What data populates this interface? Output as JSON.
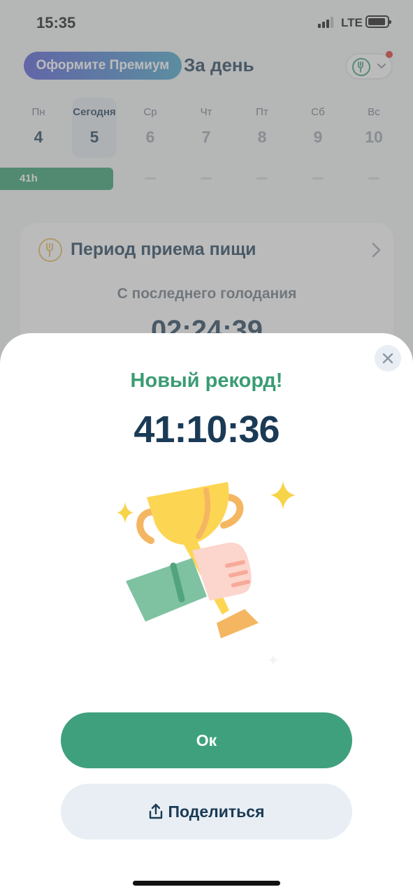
{
  "status_bar": {
    "time": "15:35",
    "network": "LTE"
  },
  "header": {
    "premium_label": "Оформите Премиум",
    "title": "За день",
    "diet_icon": "fork-icon"
  },
  "week": {
    "days": [
      {
        "name": "Пн",
        "num": "4",
        "state": "past"
      },
      {
        "name": "Сегодня",
        "num": "5",
        "state": "today"
      },
      {
        "name": "Ср",
        "num": "6",
        "state": "future"
      },
      {
        "name": "Чт",
        "num": "7",
        "state": "future"
      },
      {
        "name": "Пт",
        "num": "8",
        "state": "future"
      },
      {
        "name": "Сб",
        "num": "9",
        "state": "future"
      },
      {
        "name": "Вс",
        "num": "10",
        "state": "future"
      }
    ],
    "fast_label": "41h"
  },
  "card": {
    "title": "Период приема пищи",
    "subtitle": "С последнего голодания",
    "timer": "02:24:39"
  },
  "sheet": {
    "title": "Новый рекорд!",
    "record_time": "41:10:36",
    "ok_label": "Ок",
    "share_label": "Поделиться",
    "illustration": "trophy-hand-illustration"
  },
  "colors": {
    "accent_green": "#3fa07d",
    "text_dark": "#1a3a55",
    "premium_start": "#4c55d6",
    "premium_end": "#3fa3c8"
  }
}
